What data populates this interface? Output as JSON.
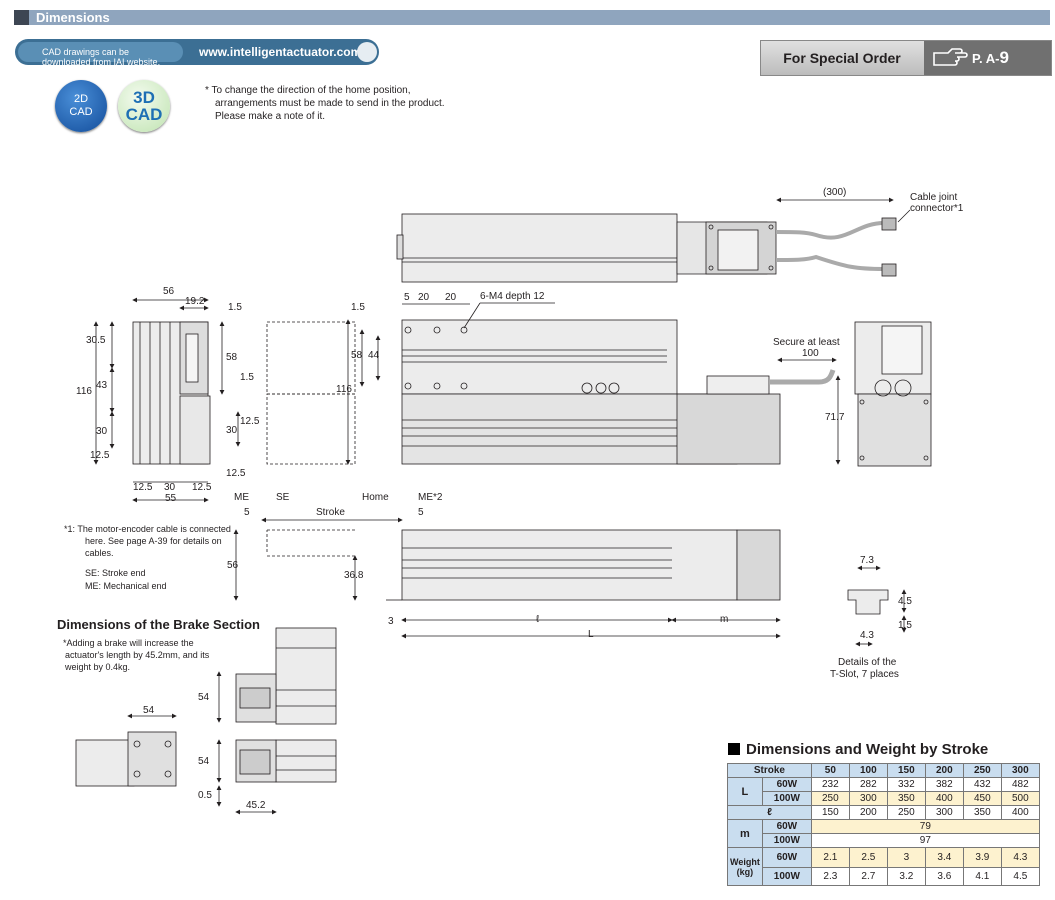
{
  "header": {
    "title": "Dimensions"
  },
  "cad": {
    "line1": "CAD drawings can be",
    "line2": "downloaded from IAI website.",
    "url": "www.intelligentactuator.com",
    "badge2d_a": "2D",
    "badge2d_b": "CAD",
    "badge3d_a": "3D",
    "badge3d_b": "CAD"
  },
  "home_note": {
    "line1": "* To change the direction of the home position,",
    "line2": "arrangements must be made to send in the product.",
    "line3": "Please make a note of it."
  },
  "special_order": {
    "label": "For Special Order",
    "page_prefix": "P. A-",
    "page_num": "9"
  },
  "drawing": {
    "d300": "(300)",
    "cable1": "Cable joint",
    "cable2": "connector*1",
    "d56": "56",
    "d19_2": "19.2",
    "d1_5a": "1.5",
    "d30_5": "30.5",
    "d43": "43",
    "d116": "116",
    "d30a": "30",
    "d12_5a": "12.5",
    "d58": "58",
    "d1_5b": "1.5",
    "d12_5b": "12.5",
    "d30b": "30",
    "d12_5c": "12.5",
    "b12_5a": "12.5",
    "b30": "30",
    "b12_5b": "12.5",
    "b55": "55",
    "t5": "5",
    "t20a": "20",
    "t20b": "20",
    "m4": "6-M4 depth 12",
    "s1_5": "1.5",
    "s58": "58",
    "s44": "44",
    "s116": "116",
    "secure": "Secure at least",
    "s100": "100",
    "s71_7": "71.7",
    "me": "ME",
    "se": "SE",
    "stroke": "Stroke",
    "home": "Home",
    "me2": "ME*2",
    "l5a": "5",
    "l5b": "5",
    "l56": "56",
    "l36_8": "36.8",
    "l3": "3",
    "lsmall": "ℓ",
    "lL": "L",
    "lm": "m",
    "tslot_7_3": "7.3",
    "tslot_4_5": "4.5",
    "tslot_1_5": "1.5",
    "tslot_4_3": "4.3",
    "tslot_cap1": "Details of the",
    "tslot_cap2": "T-Slot, 7 places",
    "brake_54a": "54",
    "brake_54b": "54",
    "brake_54c": "54",
    "brake_0_5": "0.5",
    "brake_45_2": "45.2"
  },
  "footnotes": {
    "n1a": "*1:   The motor-encoder cable is connected",
    "n1b": "here. See page A-39 for details on",
    "n1c": "cables.",
    "se": "SE: Stroke end",
    "me": "ME: Mechanical end"
  },
  "brake": {
    "title": "Dimensions of the Brake Section",
    "n1": "*Adding a brake will increase the",
    "n2": "actuator's length by 45.2mm, and its",
    "n3": "weight by 0.4kg."
  },
  "table": {
    "title": "Dimensions and Weight by Stroke",
    "stroke_label": "Stroke",
    "strokes": [
      "50",
      "100",
      "150",
      "200",
      "250",
      "300"
    ],
    "L_label": "L",
    "L_60_label": "60W",
    "L_60": [
      "232",
      "282",
      "332",
      "382",
      "432",
      "482"
    ],
    "L_100_label": "100W",
    "L_100": [
      "250",
      "300",
      "350",
      "400",
      "450",
      "500"
    ],
    "l_label": "ℓ",
    "l_vals": [
      "150",
      "200",
      "250",
      "300",
      "350",
      "400"
    ],
    "m_label": "m",
    "m_60_label": "60W",
    "m_60": "79",
    "m_100_label": "100W",
    "m_100": "97",
    "w_label1": "Weight",
    "w_label2": "(kg)",
    "w_60_label": "60W",
    "w_60": [
      "2.1",
      "2.5",
      "3",
      "3.4",
      "3.9",
      "4.3"
    ],
    "w_100_label": "100W",
    "w_100": [
      "2.3",
      "2.7",
      "3.2",
      "3.6",
      "4.1",
      "4.5"
    ]
  }
}
